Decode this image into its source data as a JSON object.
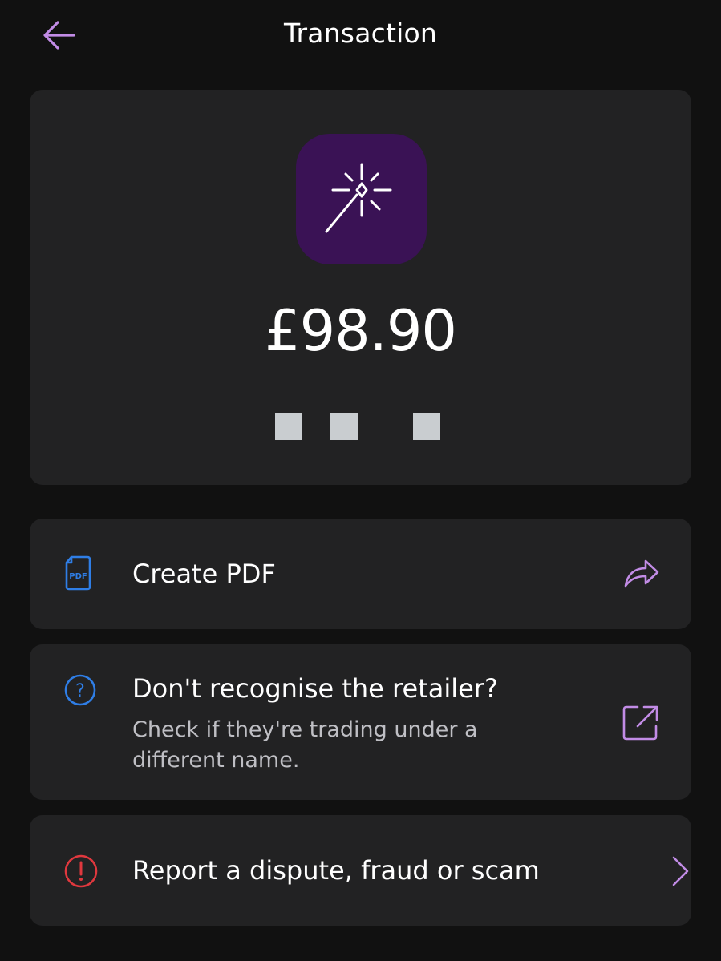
{
  "header": {
    "title": "Transaction",
    "back_icon": "arrow-left-icon"
  },
  "transaction": {
    "merchant_icon": "magic-wand-icon",
    "amount": "£98.90"
  },
  "actions": [
    {
      "label": "Create PDF",
      "leading_icon": "pdf-file-icon",
      "trailing_icon": "share-icon"
    },
    {
      "label": "Don't recognise the retailer?",
      "sublabel": "Check if they're trading under a different name.",
      "leading_icon": "question-circle-icon",
      "trailing_icon": "external-link-icon"
    },
    {
      "label": "Report a dispute, fraud or scam",
      "leading_icon": "alert-circle-icon",
      "trailing_icon": "chevron-right-icon"
    }
  ],
  "colors": {
    "background": "#111111",
    "card": "#222223",
    "accent_purple": "#c28ce6",
    "merchant_bg": "#3a1255",
    "info_blue": "#2f7ee6",
    "danger_red": "#e0383e"
  }
}
